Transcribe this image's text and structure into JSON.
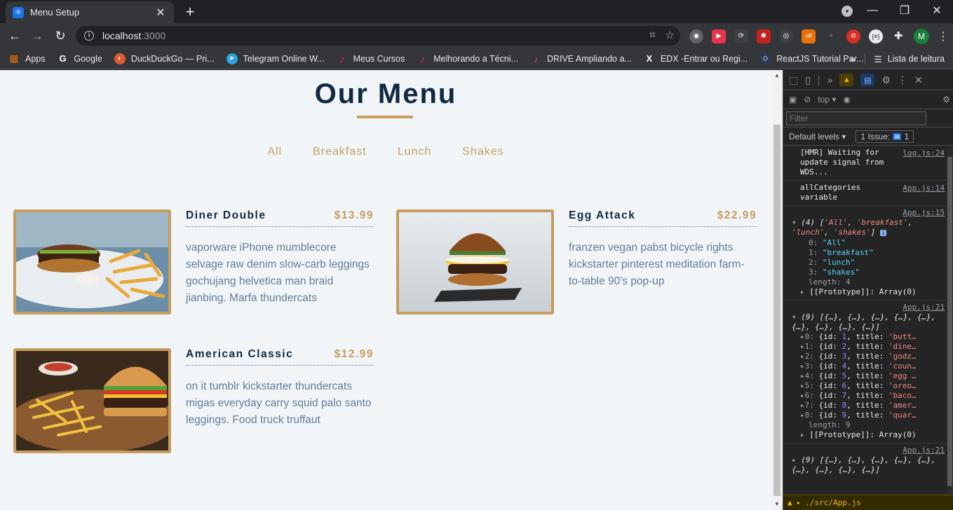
{
  "browser": {
    "tab_title": "Menu Setup",
    "url_host": "localhost",
    "url_port": ":3000",
    "bookmarks": [
      {
        "label": "Apps",
        "icon": "apps-grid-icon",
        "color": "#e8710a"
      },
      {
        "label": "Google",
        "icon": "google-icon",
        "color": "#ffffff"
      },
      {
        "label": "DuckDuckGo — Pri...",
        "icon": "duckduckgo-icon",
        "color": "#de5833"
      },
      {
        "label": "Telegram Online W...",
        "icon": "telegram-icon",
        "color": "#2aa3e0"
      },
      {
        "label": "Meus Cursos",
        "icon": "music-note-icon",
        "color": "#e8334a"
      },
      {
        "label": "Melhorando a Técni...",
        "icon": "music-note-icon",
        "color": "#e8334a"
      },
      {
        "label": "DRIVE Ampliando a...",
        "icon": "music-note-icon",
        "color": "#e8334a"
      },
      {
        "label": "EDX -Entrar ou Regi...",
        "icon": "edx-icon",
        "color": "#ffffff"
      },
      {
        "label": "ReactJS Tutorial Par...",
        "icon": "react-icon",
        "color": "#2b3a55"
      }
    ],
    "reading_list": "Lista de leitura",
    "extension_badge": "off",
    "avatar_letter": "M"
  },
  "page": {
    "title": "Our Menu",
    "filters": [
      "All",
      "Breakfast",
      "Lunch",
      "Shakes"
    ],
    "items": [
      {
        "name": "Diner Double",
        "price": "$13.99",
        "description": "vaporware iPhone mumblecore selvage raw denim slow-carb leggings gochujang helvetica man braid jianbing. Marfa thundercats"
      },
      {
        "name": "Egg Attack",
        "price": "$22.99",
        "description": "franzen vegan pabst bicycle rights kickstarter pinterest meditation farm-to-table 90's pop-up"
      },
      {
        "name": "American Classic",
        "price": "$12.99",
        "description": "on it tumblr kickstarter thundercats migas everyday carry squid palo santo leggings. Food truck truffaut"
      }
    ],
    "colors": {
      "title": "#102a42",
      "accent": "#c59d5f",
      "text": "#617d98",
      "background": "#f1f5f8"
    }
  },
  "devtools": {
    "context": "top",
    "filter_placeholder": "Filter",
    "levels": "Default levels",
    "issues": "1 Issue:",
    "issues_count": "1",
    "warning_path": "./src/App.js",
    "log1_text": "[HMR] Waiting for update signal from WDS...",
    "log1_src": "log.js:24",
    "log2_text": "allCategories variable",
    "log2_src": "App.js:14",
    "log3_src": "App.js:15",
    "log3_summary_count": "(4)",
    "log3_summary": [
      "'All'",
      "'breakfast'",
      "'lunch'",
      "'shakes'"
    ],
    "categories": [
      {
        "key": "0:",
        "value": "\"All\""
      },
      {
        "key": "1:",
        "value": "\"breakfast\""
      },
      {
        "key": "2:",
        "value": "\"lunch\""
      },
      {
        "key": "3:",
        "value": "\"shakes\""
      }
    ],
    "length4": "length: 4",
    "prototype": "[[Prototype]]: Array(0)",
    "log4_src": "App.js:21",
    "log4_summary": "(9) [{…}, {…}, {…}, {…}, {…}, {…}, {…}, {…}, {…}]",
    "objects": [
      {
        "key": "0:",
        "id": "1",
        "title": "'butt…"
      },
      {
        "key": "1:",
        "id": "2",
        "title": "'dine…"
      },
      {
        "key": "2:",
        "id": "3",
        "title": "'godz…"
      },
      {
        "key": "3:",
        "id": "4",
        "title": "'coun…"
      },
      {
        "key": "4:",
        "id": "5",
        "title": "'egg …"
      },
      {
        "key": "5:",
        "id": "6",
        "title": "'oreo…"
      },
      {
        "key": "6:",
        "id": "7",
        "title": "'baco…"
      },
      {
        "key": "7:",
        "id": "8",
        "title": "'amer…"
      },
      {
        "key": "8:",
        "id": "9",
        "title": "'quar…"
      }
    ],
    "length9": "length: 9",
    "log5_src": "App.js:21",
    "log5_summary": "(9) [{…}, {…}, {…}, {…}, {…}, {…}, {…}, {…}, {…}]"
  }
}
